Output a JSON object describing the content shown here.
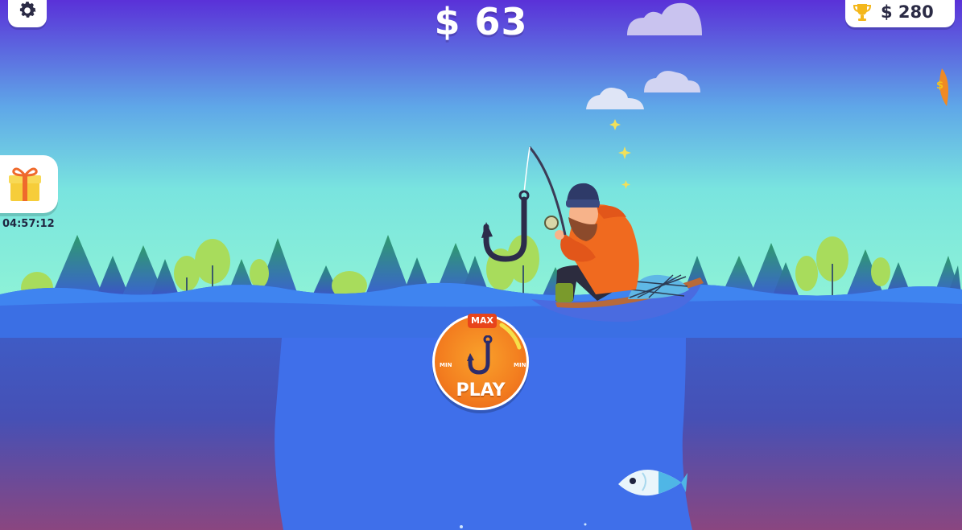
{
  "hud": {
    "money": "$ 63",
    "trophy_amount": "$ 280",
    "gift_timer": "04:57:12"
  },
  "play_button": {
    "label": "PLAY",
    "max_label": "MAX",
    "min_left_label": "MIN",
    "min_right_label": "MIN"
  },
  "icons": {
    "settings": "gear-icon",
    "trophy": "trophy-icon",
    "gift": "gift-icon",
    "hook": "fishing-hook-icon"
  },
  "colors": {
    "sky_top": "#5a31d8",
    "sky_mid": "#5ecde8",
    "sky_horizon": "#86f2dc",
    "water": "#3a6de6",
    "water_deep": "#6b3f9a",
    "play_orange": "#f37d1f",
    "fisherman_coat": "#f06a1f",
    "trophy_gold": "#f4b71b"
  }
}
